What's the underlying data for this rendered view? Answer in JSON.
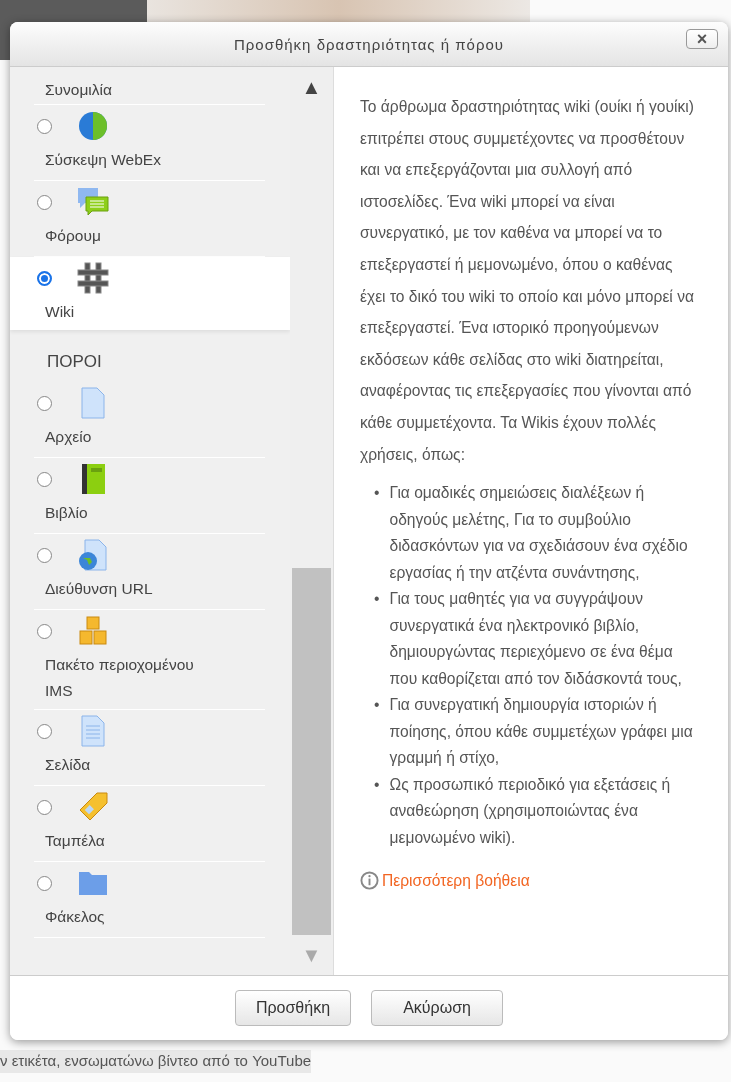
{
  "dialog": {
    "title": "Προσθήκη δραστηριότητας ή πόρου",
    "close": "×"
  },
  "options": [
    {
      "kind": "cut",
      "label": "Συνομιλία"
    },
    {
      "kind": "option",
      "label": "Σύσκεψη WebEx",
      "selected": false
    },
    {
      "kind": "option",
      "label": "Φόρουμ",
      "selected": false
    },
    {
      "kind": "option",
      "label": "Wiki",
      "selected": true
    },
    {
      "kind": "heading",
      "label": "ΠΟΡΟΙ"
    },
    {
      "kind": "option",
      "label": "Αρχείο",
      "selected": false
    },
    {
      "kind": "option",
      "label": "Βιβλίο",
      "selected": false
    },
    {
      "kind": "option",
      "label": "Διεύθυνση URL",
      "selected": false
    },
    {
      "kind": "option",
      "label": "Πακέτο περιοχομένου IMS",
      "selected": false
    },
    {
      "kind": "option",
      "label": "Σελίδα",
      "selected": false
    },
    {
      "kind": "option",
      "label": "Ταμπέλα",
      "selected": false
    },
    {
      "kind": "option",
      "label": "Φάκελος",
      "selected": false
    }
  ],
  "scroll_up": "▲",
  "scroll_down": "▼",
  "description": {
    "paragraph": "Το άρθρωμα δραστηριότητας wiki (ουίκι ή γουίκι) επιτρέπει στους συμμετέχοντες να προσθέτουν και να επεξεργάζονται μια συλλογή από ιστοσελίδες. Ένα wiki μπορεί να είναι συνεργατικό, με τον καθένα να μπορεί να το επεξεργαστεί ή μεμονωμένο, όπου ο καθένας έχει το δικό του wiki το οποίο και μόνο μπορεί να επεξεργαστεί. Ένα ιστορικό προηγούμενων εκδόσεων κάθε σελίδας στο wiki διατηρείται, αναφέροντας τις επεξεργασίες που γίνονται από κάθε συμμετέχοντα. Τα Wikis έχουν πολλές χρήσεις, όπως:",
    "bullets": [
      {
        "marker": "•",
        "text": "Για ομαδικές σημειώσεις διαλέξεων ή οδηγούς μελέτης, Για το συμβούλιο διδασκόντων για να σχεδιάσουν ένα σχέδιο εργασίας ή την ατζέντα συνάντησης,"
      },
      {
        "marker": "•",
        "text": "Για τους μαθητές για να συγγράψουν συνεργατικά ένα ηλεκτρονικό βιβλίο, δημιουργώντας περιεχόμενο σε ένα θέμα που καθορίζεται από τον διδάσκοντά τους,"
      },
      {
        "marker": "•",
        "text": "Για συνεργατική δημιουργία ιστοριών ή ποίησης, όπου κάθε συμμετέχων γράφει μια γραμμή ή στίχο,"
      },
      {
        "marker": "•",
        "text": "Ως προσωπικό περιοδικό για εξετάσεις ή αναθεώρηση (χρησιμοποιώντας ένα μεμονωμένο wiki)."
      }
    ],
    "help_link": "Περισσότερη βοήθεια"
  },
  "buttons": [
    "Προσθήκη",
    "Ακύρωση"
  ],
  "background_text": "ν ετικέτα, ενσωματώνω βίντεο από το YouTube"
}
